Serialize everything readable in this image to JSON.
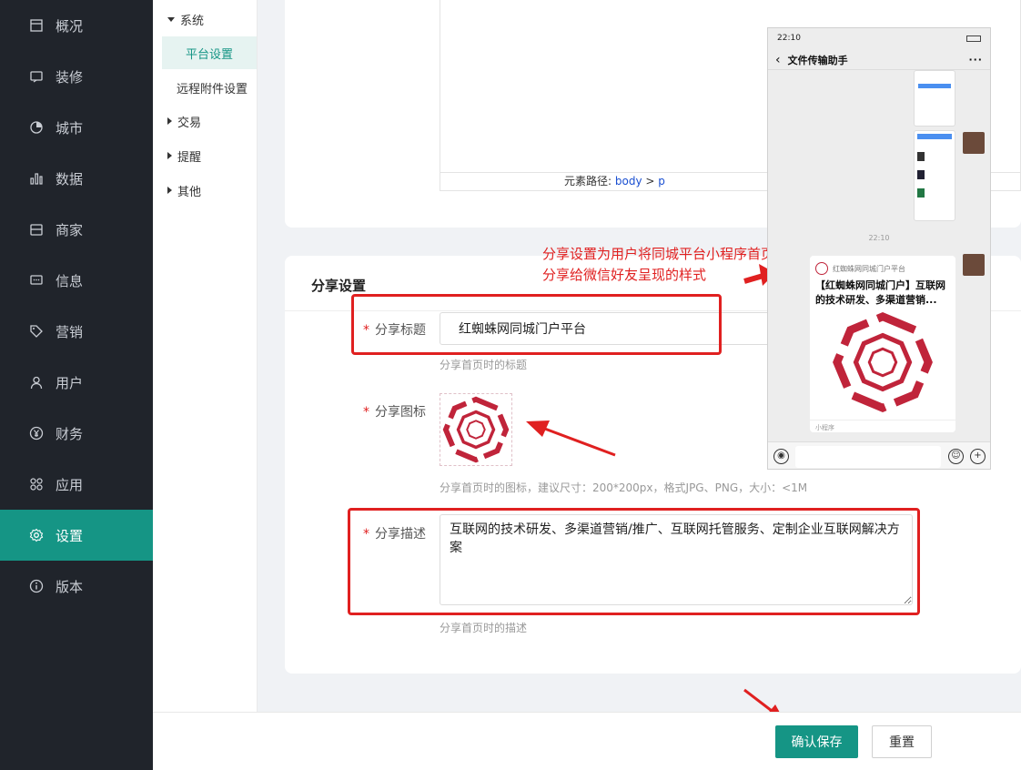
{
  "sidebar": {
    "items": [
      {
        "label": "概况",
        "icon": "dashboard-icon"
      },
      {
        "label": "装修",
        "icon": "decorate-icon"
      },
      {
        "label": "城市",
        "icon": "city-icon"
      },
      {
        "label": "数据",
        "icon": "chart-icon"
      },
      {
        "label": "商家",
        "icon": "store-icon"
      },
      {
        "label": "信息",
        "icon": "message-icon"
      },
      {
        "label": "营销",
        "icon": "tag-icon"
      },
      {
        "label": "用户",
        "icon": "user-icon"
      },
      {
        "label": "财务",
        "icon": "yen-icon"
      },
      {
        "label": "应用",
        "icon": "apps-icon"
      },
      {
        "label": "设置",
        "icon": "gear-icon"
      },
      {
        "label": "版本",
        "icon": "info-icon"
      }
    ],
    "active_index": 10
  },
  "subnav": {
    "group_system": "系统",
    "item_platform": "平台设置",
    "item_remote": "远程附件设置",
    "group_trade": "交易",
    "group_remind": "提醒",
    "group_other": "其他"
  },
  "editor": {
    "path_label": "元素路径:",
    "path_body": "body",
    "path_sep": ">",
    "path_p": "p"
  },
  "share": {
    "section_title": "分享设置",
    "title_label": "分享标题",
    "title_value": "红蜘蛛网同城门户平台",
    "title_help": "分享首页时的标题",
    "icon_label": "分享图标",
    "icon_help": "分享首页时的图标，建议尺寸：200*200px，格式JPG、PNG，大小：<1M",
    "desc_label": "分享描述",
    "desc_value": "互联网的技术研发、多渠道营销/推广、互联网托管服务、定制企业互联网解决方案",
    "desc_help": "分享首页时的描述",
    "required_mark": "*"
  },
  "buttons": {
    "save": "确认保存",
    "reset": "重置"
  },
  "annotation": {
    "line1": "分享设置为用户将同城平台小程序首页",
    "line2": "分享给微信好友呈现的样式"
  },
  "phone": {
    "time": "22:10",
    "chat_title": "文件传输助手",
    "more": "···",
    "msg_time": "22:10",
    "card_source": "红蜘蛛网同城门户平台",
    "card_title": "【红蜘蛛网同城门户】互联网的技术研发、多渠道营销...",
    "card_footer": "小程序"
  },
  "colors": {
    "primary": "#159585",
    "sidebar_bg": "#20242b",
    "accent_red": "#e02020",
    "logo_red": "#c0243a"
  }
}
